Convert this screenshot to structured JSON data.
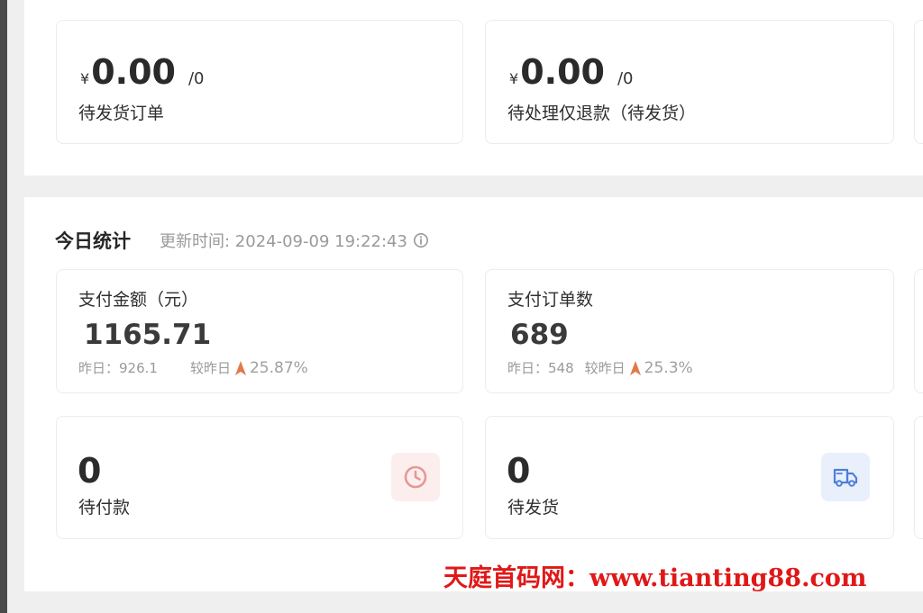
{
  "top_cards": [
    {
      "currency": "¥",
      "amount": "0.00",
      "count": "/0",
      "label": "待发货订单"
    },
    {
      "currency": "¥",
      "amount": "0.00",
      "count": "/0",
      "label": "待处理仅退款（待发货）"
    }
  ],
  "today": {
    "title": "今日统计",
    "update_time": "更新时间: 2024-09-09 19:22:43",
    "stats": [
      {
        "title": "支付金额（元）",
        "value": "1165.71",
        "yesterday": "昨日：926.1",
        "compare_label": "较昨日",
        "change": "25.87%"
      },
      {
        "title": "支付订单数",
        "value": "689",
        "yesterday": "昨日：548",
        "compare_label": "较昨日",
        "change": "25.3%"
      }
    ],
    "pending": [
      {
        "value": "0",
        "label": "待付款",
        "icon": "clock-icon"
      },
      {
        "value": "0",
        "label": "待发货",
        "icon": "truck-icon"
      }
    ]
  },
  "watermark": "天庭首码网：www.tianting88.com",
  "colors": {
    "background": "#efefef",
    "card": "#ffffff",
    "up_arrow": "#e07a4a",
    "clock_bg": "#fdeeee",
    "clock_icon": "#e39a95",
    "truck_bg": "#e9f0fc",
    "truck_icon": "#4f7ed8",
    "watermark": "#e01818"
  }
}
